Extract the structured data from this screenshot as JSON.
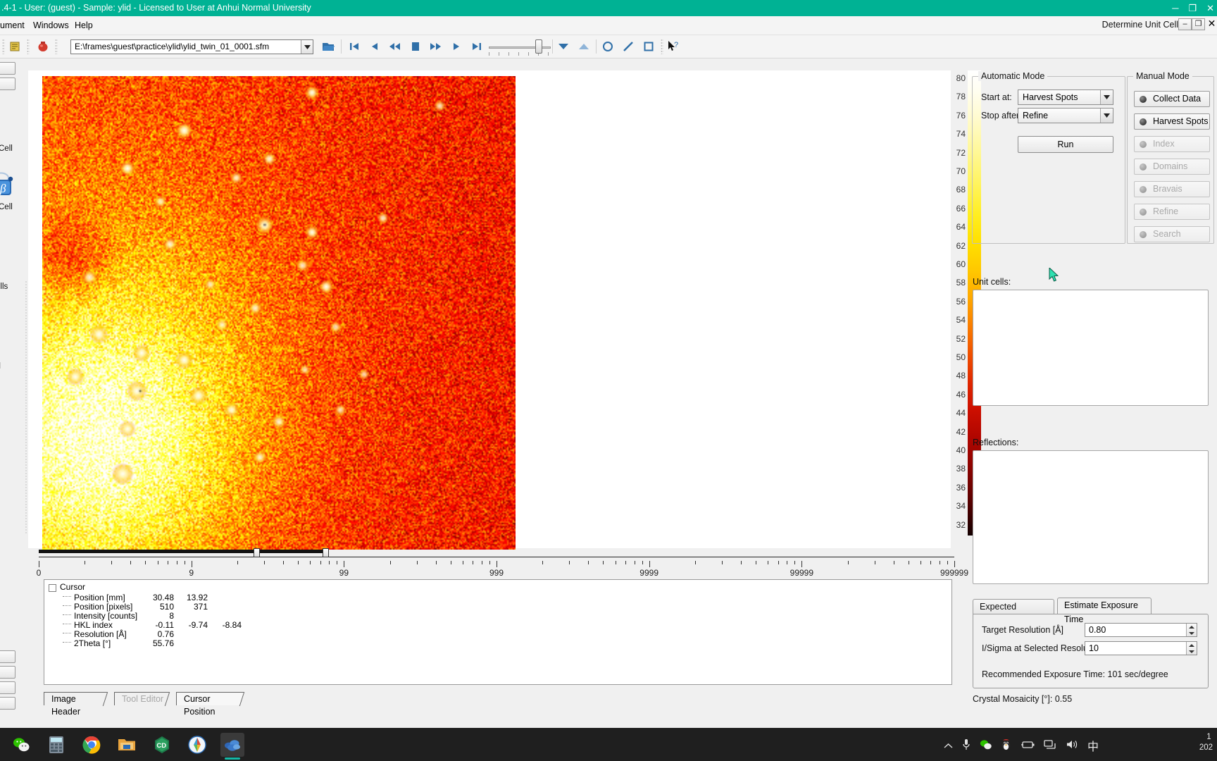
{
  "window": {
    "title": ".4-1 - User: (guest) - Sample: ylid - Licensed to User at Anhui Normal University",
    "min": "─",
    "max": "❐",
    "close": "✕"
  },
  "menubar": {
    "items": [
      "ument",
      "Windows",
      "Help"
    ],
    "right_label": "Determine Unit Cell",
    "min": "–",
    "restore": "❐",
    "close": "✕"
  },
  "toolbar": {
    "path_value": "E:\\frames\\guest\\practice\\ylid\\ylid_twin_01_0001.sfm",
    "path_placeholder": "frame path",
    "icons": [
      "note-icon",
      "stop-record-icon",
      "open-folder-icon",
      "first-frame-icon",
      "prev-frame-icon",
      "rewind-icon",
      "stop-icon",
      "fast-forward-icon",
      "play-icon",
      "last-frame-icon",
      "contrast-down-icon",
      "contrast-up-icon",
      "circle-tool-icon",
      "line-tool-icon",
      "box-tool-icon",
      "help-pointer-icon"
    ]
  },
  "left_panel": {
    "fragments": [
      "Cell",
      "Cell",
      "ells",
      "al"
    ],
    "beta_icon": "beta-crystal-icon"
  },
  "image": {
    "name": "diffraction-frame",
    "alt": "X-ray diffraction frame, red hot colormap with bright Bragg spots"
  },
  "colorbar": {
    "labels": [
      80,
      78,
      76,
      74,
      72,
      70,
      68,
      66,
      64,
      62,
      60,
      58,
      56,
      54,
      52,
      50,
      48,
      46,
      44,
      42,
      40,
      38,
      36,
      34,
      32
    ]
  },
  "ruler": {
    "labels": [
      "0",
      "9",
      "99",
      "999",
      "9999",
      "99999",
      "999999"
    ]
  },
  "cursor_info": {
    "root": "Cursor",
    "rows": [
      {
        "label": "Position [mm]",
        "v1": "30.48",
        "v2": "13.92",
        "v3": ""
      },
      {
        "label": "Position [pixels]",
        "v1": "510",
        "v2": "371",
        "v3": ""
      },
      {
        "label": "Intensity [counts]",
        "v1": "8",
        "v2": "",
        "v3": ""
      },
      {
        "label": "HKL index",
        "v1": "-0.11",
        "v2": "-9.74",
        "v3": "-8.84"
      },
      {
        "label": "Resolution [Å]",
        "v1": "0.76",
        "v2": "",
        "v3": ""
      },
      {
        "label": "2Theta [°]",
        "v1": "55.76",
        "v2": "",
        "v3": ""
      }
    ]
  },
  "bottom_tabs": [
    {
      "label": "Image Header",
      "state": "normal"
    },
    {
      "label": "Tool Editor",
      "state": "disabled"
    },
    {
      "label": "Cursor Position",
      "state": "active"
    }
  ],
  "automatic_mode": {
    "legend": "Automatic Mode",
    "start_label": "Start at:",
    "start_value": "Harvest Spots",
    "stop_label": "Stop after:",
    "stop_value": "Refine",
    "run_label": "Run"
  },
  "manual_mode": {
    "legend": "Manual Mode",
    "buttons": [
      {
        "label": "Collect Data",
        "enabled": true
      },
      {
        "label": "Harvest Spots",
        "enabled": true
      },
      {
        "label": "Index",
        "enabled": false
      },
      {
        "label": "Domains",
        "enabled": false
      },
      {
        "label": "Bravais",
        "enabled": false
      },
      {
        "label": "Refine",
        "enabled": false
      },
      {
        "label": "Search",
        "enabled": false
      }
    ]
  },
  "unit_cells": {
    "label": "Unit cells:",
    "content": ""
  },
  "reflections": {
    "label": "Reflections:",
    "content": ""
  },
  "exposure_panel": {
    "tabs": [
      {
        "label": "Expected Resolution",
        "active": false
      },
      {
        "label": "Estimate  Exposure Time",
        "active": true
      }
    ],
    "target_resolution_label": "Target Resolution [Å]",
    "target_resolution_value": "0.80",
    "isigma_label": "I/Sigma at Selected Resolution",
    "isigma_value": "10",
    "recommended": "Recommended Exposure Time: 101 sec/degree",
    "mosaicity": "Crystal Mosaicity [°]: 0.55"
  },
  "taskbar": {
    "icons": [
      "wechat-icon",
      "calculator-icon",
      "chrome-icon",
      "file-explorer-icon",
      "cd-app-icon",
      "compass-app-icon",
      "apex-app-icon"
    ],
    "tray": [
      "chevron-up-icon",
      "microphone-icon",
      "wechat-tray-icon",
      "qq-penguin-icon",
      "battery-icon",
      "network-icon",
      "volume-icon"
    ],
    "ime": "中",
    "clock_time": "1 ",
    "clock_date": "202"
  },
  "colors": {
    "title_bar": "#00b294",
    "accent": "#14b8a6",
    "panel": "#f0f0f0"
  }
}
